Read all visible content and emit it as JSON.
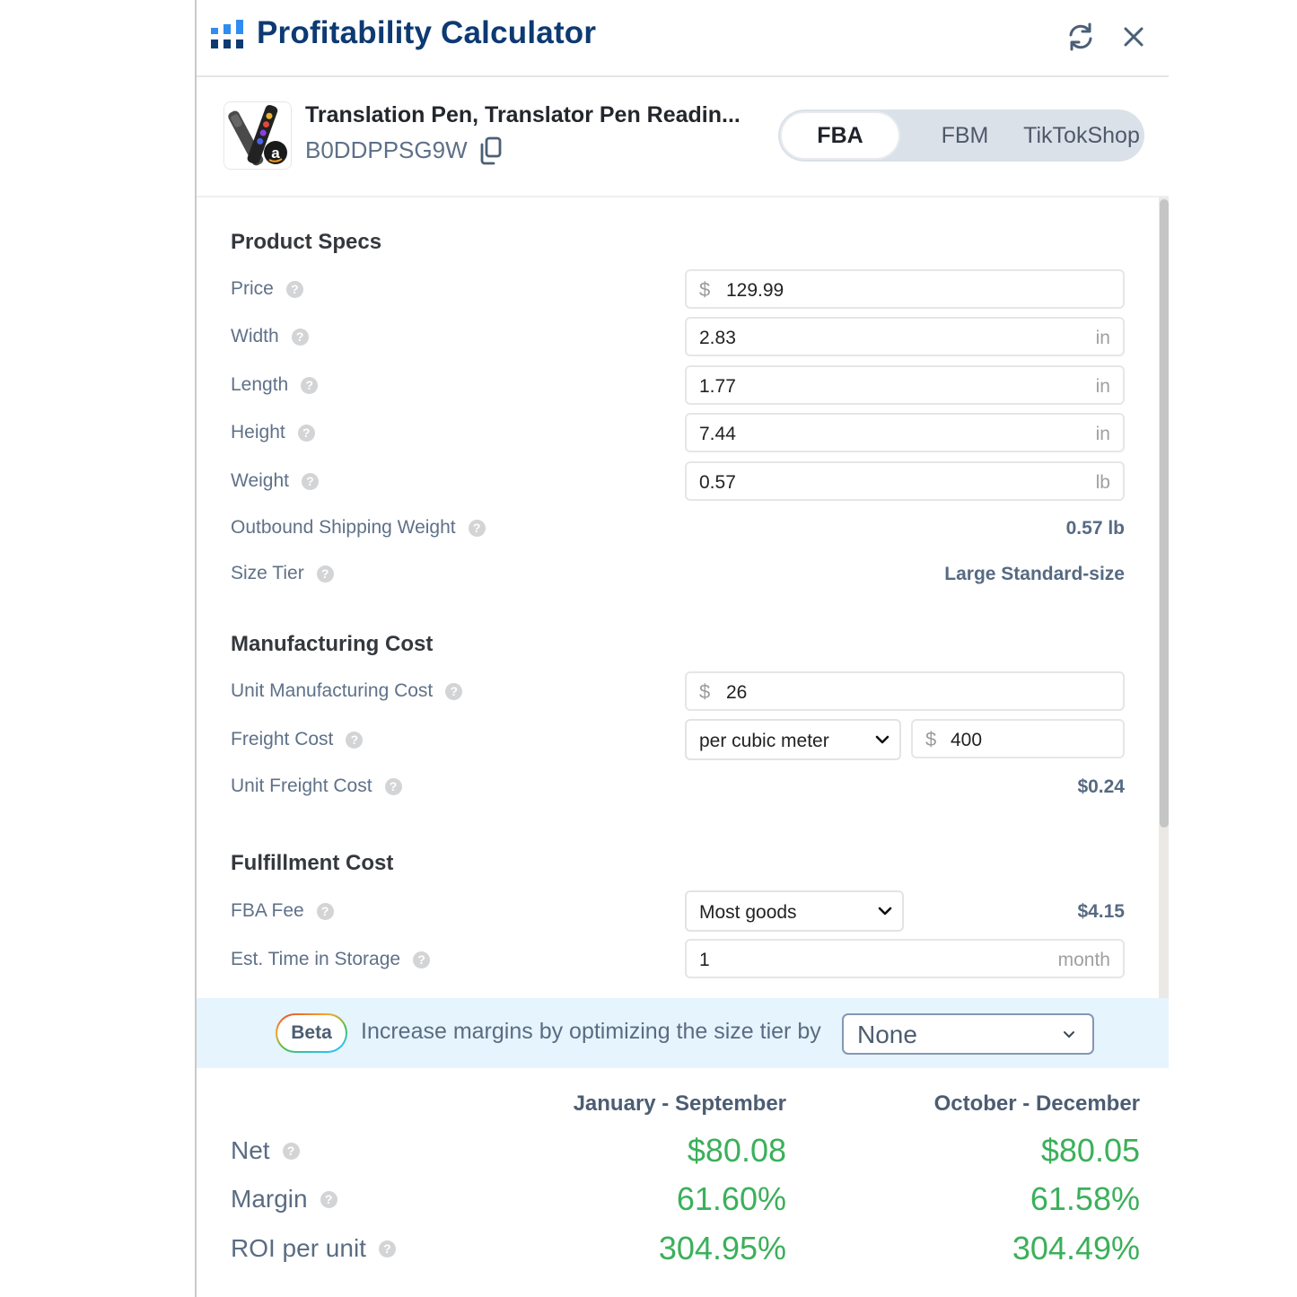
{
  "app": {
    "title": "Profitability Calculator",
    "icons": {
      "logo": "bar-chart-logo-icon",
      "refresh": "refresh-icon",
      "close": "close-icon"
    }
  },
  "product": {
    "name": "Translation Pen, Translator Pen Readin...",
    "asin": "B0DDPPSG9W",
    "copy_icon": "copy-icon",
    "thumbnail": "translation-pen-with-amazon-badge"
  },
  "tabs": [
    {
      "label": "FBA",
      "active": true
    },
    {
      "label": "FBM",
      "active": false
    },
    {
      "label": "TikTokShop",
      "active": false
    }
  ],
  "help_glyph": "?",
  "sections": {
    "product_specs": {
      "title": "Product Specs",
      "price": {
        "label": "Price",
        "currency": "$",
        "value": "129.99"
      },
      "width": {
        "label": "Width",
        "value": "2.83",
        "unit": "in"
      },
      "length": {
        "label": "Length",
        "value": "1.77",
        "unit": "in"
      },
      "height": {
        "label": "Height",
        "value": "7.44",
        "unit": "in"
      },
      "weight": {
        "label": "Weight",
        "value": "0.57",
        "unit": "lb"
      },
      "outbound_weight": {
        "label": "Outbound Shipping Weight",
        "value": "0.57 lb"
      },
      "size_tier": {
        "label": "Size Tier",
        "value": "Large Standard-size"
      }
    },
    "manufacturing_cost": {
      "title": "Manufacturing Cost",
      "unit_cost": {
        "label": "Unit Manufacturing Cost",
        "currency": "$",
        "value": "26"
      },
      "freight_cost": {
        "label": "Freight Cost",
        "basis": "per cubic meter",
        "currency": "$",
        "value": "400"
      },
      "unit_freight_cost": {
        "label": "Unit Freight Cost",
        "value": "$0.24"
      }
    },
    "fulfillment_cost": {
      "title": "Fulfillment Cost",
      "fba_fee": {
        "label": "FBA Fee",
        "category": "Most goods",
        "value": "$4.15"
      },
      "storage_time": {
        "label": "Est. Time in Storage",
        "value": "1",
        "unit": "month"
      }
    }
  },
  "banner": {
    "badge": "Beta",
    "text": "Increase margins by optimizing the size tier by",
    "option": "None"
  },
  "results": {
    "columns": [
      "January - September",
      "October - December"
    ],
    "rows": [
      {
        "label": "Net",
        "values": [
          "$80.08",
          "$80.05"
        ]
      },
      {
        "label": "Margin",
        "values": [
          "61.60%",
          "61.58%"
        ]
      },
      {
        "label": "ROI per unit",
        "values": [
          "304.95%",
          "304.49%"
        ]
      }
    ]
  },
  "colors": {
    "title": "#0d3a72",
    "logo_light": "#2f8cf0",
    "positive": "#3bb05a",
    "label": "#5f7188",
    "banner_bg": "#e6f4fd"
  }
}
